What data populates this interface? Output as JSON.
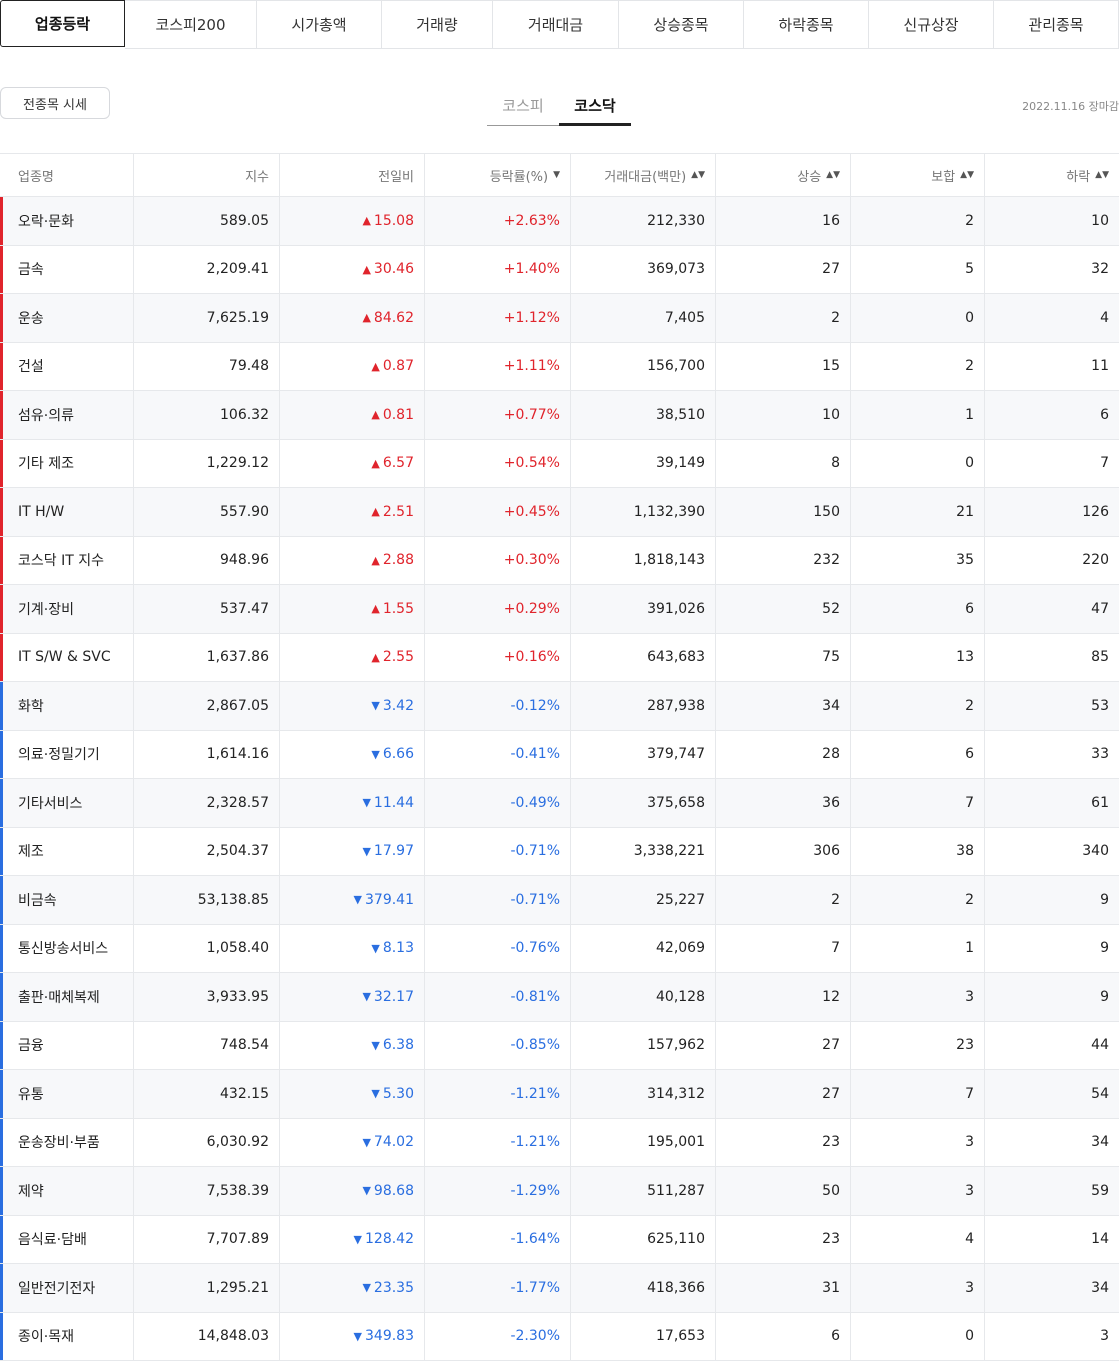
{
  "tabs": [
    "업종등락",
    "코스피200",
    "시가총액",
    "거래량",
    "거래대금",
    "상승종목",
    "하락종목",
    "신규상장",
    "관리종목"
  ],
  "all_quotes_label": "전종목 시세",
  "market_tabs": [
    "코스피",
    "코스닥"
  ],
  "timestamp": "2022.11.16 장마감",
  "columns": [
    "업종명",
    "지수",
    "전일비",
    "등락률(%)",
    "거래대금(백만)",
    "상승",
    "보합",
    "하락"
  ],
  "sort_icons": {
    "rate": "▼",
    "sortable": "▲▼"
  },
  "colors": {
    "up": "#e0242c",
    "down": "#2a6ee0"
  },
  "rows": [
    {
      "name": "오락·문화",
      "index": "589.05",
      "dir": "up",
      "change": "15.08",
      "rate": "+2.63%",
      "amount": "212,330",
      "rise": "16",
      "flat": "2",
      "fall": "10"
    },
    {
      "name": "금속",
      "index": "2,209.41",
      "dir": "up",
      "change": "30.46",
      "rate": "+1.40%",
      "amount": "369,073",
      "rise": "27",
      "flat": "5",
      "fall": "32"
    },
    {
      "name": "운송",
      "index": "7,625.19",
      "dir": "up",
      "change": "84.62",
      "rate": "+1.12%",
      "amount": "7,405",
      "rise": "2",
      "flat": "0",
      "fall": "4"
    },
    {
      "name": "건설",
      "index": "79.48",
      "dir": "up",
      "change": "0.87",
      "rate": "+1.11%",
      "amount": "156,700",
      "rise": "15",
      "flat": "2",
      "fall": "11"
    },
    {
      "name": "섬유·의류",
      "index": "106.32",
      "dir": "up",
      "change": "0.81",
      "rate": "+0.77%",
      "amount": "38,510",
      "rise": "10",
      "flat": "1",
      "fall": "6"
    },
    {
      "name": "기타 제조",
      "index": "1,229.12",
      "dir": "up",
      "change": "6.57",
      "rate": "+0.54%",
      "amount": "39,149",
      "rise": "8",
      "flat": "0",
      "fall": "7"
    },
    {
      "name": "IT H/W",
      "index": "557.90",
      "dir": "up",
      "change": "2.51",
      "rate": "+0.45%",
      "amount": "1,132,390",
      "rise": "150",
      "flat": "21",
      "fall": "126"
    },
    {
      "name": "코스닥 IT 지수",
      "index": "948.96",
      "dir": "up",
      "change": "2.88",
      "rate": "+0.30%",
      "amount": "1,818,143",
      "rise": "232",
      "flat": "35",
      "fall": "220"
    },
    {
      "name": "기계·장비",
      "index": "537.47",
      "dir": "up",
      "change": "1.55",
      "rate": "+0.29%",
      "amount": "391,026",
      "rise": "52",
      "flat": "6",
      "fall": "47"
    },
    {
      "name": "IT S/W & SVC",
      "index": "1,637.86",
      "dir": "up",
      "change": "2.55",
      "rate": "+0.16%",
      "amount": "643,683",
      "rise": "75",
      "flat": "13",
      "fall": "85"
    },
    {
      "name": "화학",
      "index": "2,867.05",
      "dir": "down",
      "change": "3.42",
      "rate": "-0.12%",
      "amount": "287,938",
      "rise": "34",
      "flat": "2",
      "fall": "53"
    },
    {
      "name": "의료·정밀기기",
      "index": "1,614.16",
      "dir": "down",
      "change": "6.66",
      "rate": "-0.41%",
      "amount": "379,747",
      "rise": "28",
      "flat": "6",
      "fall": "33"
    },
    {
      "name": "기타서비스",
      "index": "2,328.57",
      "dir": "down",
      "change": "11.44",
      "rate": "-0.49%",
      "amount": "375,658",
      "rise": "36",
      "flat": "7",
      "fall": "61"
    },
    {
      "name": "제조",
      "index": "2,504.37",
      "dir": "down",
      "change": "17.97",
      "rate": "-0.71%",
      "amount": "3,338,221",
      "rise": "306",
      "flat": "38",
      "fall": "340"
    },
    {
      "name": "비금속",
      "index": "53,138.85",
      "dir": "down",
      "change": "379.41",
      "rate": "-0.71%",
      "amount": "25,227",
      "rise": "2",
      "flat": "2",
      "fall": "9"
    },
    {
      "name": "통신방송서비스",
      "index": "1,058.40",
      "dir": "down",
      "change": "8.13",
      "rate": "-0.76%",
      "amount": "42,069",
      "rise": "7",
      "flat": "1",
      "fall": "9"
    },
    {
      "name": "출판·매체복제",
      "index": "3,933.95",
      "dir": "down",
      "change": "32.17",
      "rate": "-0.81%",
      "amount": "40,128",
      "rise": "12",
      "flat": "3",
      "fall": "9"
    },
    {
      "name": "금융",
      "index": "748.54",
      "dir": "down",
      "change": "6.38",
      "rate": "-0.85%",
      "amount": "157,962",
      "rise": "27",
      "flat": "23",
      "fall": "44"
    },
    {
      "name": "유통",
      "index": "432.15",
      "dir": "down",
      "change": "5.30",
      "rate": "-1.21%",
      "amount": "314,312",
      "rise": "27",
      "flat": "7",
      "fall": "54"
    },
    {
      "name": "운송장비·부품",
      "index": "6,030.92",
      "dir": "down",
      "change": "74.02",
      "rate": "-1.21%",
      "amount": "195,001",
      "rise": "23",
      "flat": "3",
      "fall": "34"
    },
    {
      "name": "제약",
      "index": "7,538.39",
      "dir": "down",
      "change": "98.68",
      "rate": "-1.29%",
      "amount": "511,287",
      "rise": "50",
      "flat": "3",
      "fall": "59"
    },
    {
      "name": "음식료·담배",
      "index": "7,707.89",
      "dir": "down",
      "change": "128.42",
      "rate": "-1.64%",
      "amount": "625,110",
      "rise": "23",
      "flat": "4",
      "fall": "14"
    },
    {
      "name": "일반전기전자",
      "index": "1,295.21",
      "dir": "down",
      "change": "23.35",
      "rate": "-1.77%",
      "amount": "418,366",
      "rise": "31",
      "flat": "3",
      "fall": "34"
    },
    {
      "name": "종이·목재",
      "index": "14,848.03",
      "dir": "down",
      "change": "349.83",
      "rate": "-2.30%",
      "amount": "17,653",
      "rise": "6",
      "flat": "0",
      "fall": "3"
    }
  ]
}
